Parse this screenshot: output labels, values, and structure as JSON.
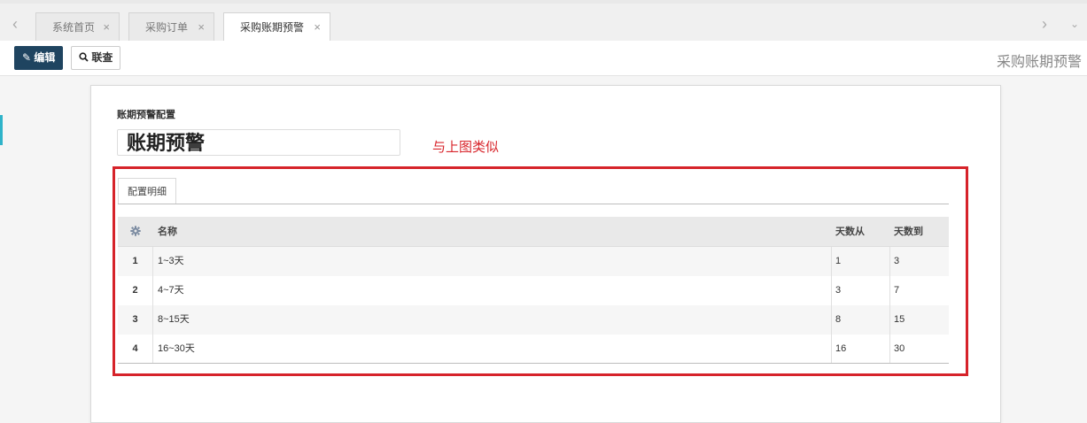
{
  "tabs": {
    "items": [
      {
        "label": "系统首页",
        "close": "×"
      },
      {
        "label": "采购订单",
        "close": "×"
      },
      {
        "label": "采购账期预警",
        "close": "×"
      }
    ],
    "prev_icon": "chevron-left-icon",
    "next_icon": "chevron-right-icon"
  },
  "toolbar": {
    "edit_label": "编辑",
    "edit_icon": "edit-icon",
    "query_label": "联查",
    "query_icon": "search-icon"
  },
  "header": {
    "title": "采购账期预警"
  },
  "form": {
    "section_label": "账期预警配置",
    "name_value": "账期预警",
    "annotation": "与上图类似",
    "annotation_color": "#d6232a"
  },
  "detail": {
    "tab_label": "配置明细",
    "settings_icon": "gear-icon",
    "columns": {
      "name": "名称",
      "from": "天数从",
      "to": "天数到"
    },
    "rows": [
      {
        "idx": "1",
        "name": "1~3天",
        "from": "1",
        "to": "3"
      },
      {
        "idx": "2",
        "name": "4~7天",
        "from": "3",
        "to": "7"
      },
      {
        "idx": "3",
        "name": "8~15天",
        "from": "8",
        "to": "15"
      },
      {
        "idx": "4",
        "name": "16~30天",
        "from": "16",
        "to": "30"
      }
    ]
  },
  "colors": {
    "primary": "#1f4460",
    "highlight_box": "#d6232a"
  }
}
